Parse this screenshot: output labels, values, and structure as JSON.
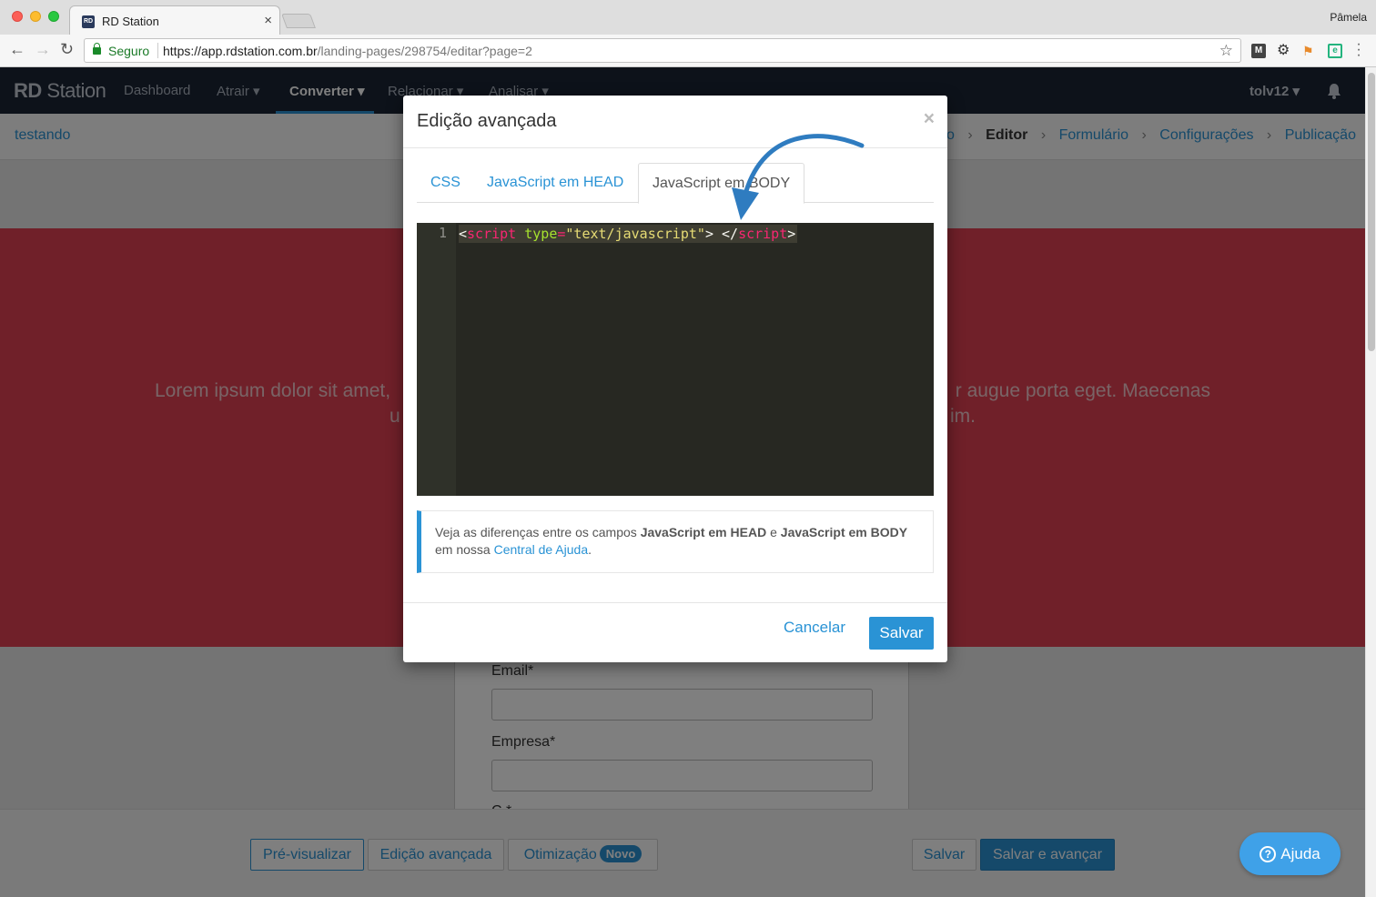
{
  "browser": {
    "tab_title": "RD Station",
    "tab_favicon_text": "RD",
    "profile_name": "Pâmela",
    "secure_label": "Seguro",
    "url_scheme_host": "https://app.rdstation.com.br",
    "url_path": "/landing-pages/298754/editar?page=2"
  },
  "app_nav": {
    "brand_bold": "RD",
    "brand_rest": " Station",
    "items": [
      {
        "label": "Dashboard"
      },
      {
        "label": "Atrair ▾"
      },
      {
        "label": "Converter ▾"
      },
      {
        "label": "Relacionar ▾"
      },
      {
        "label": "Analisar ▾"
      }
    ],
    "active_item": "Converter",
    "user": "tolv12 ▾"
  },
  "subheader": {
    "page_name": "testando",
    "steps": [
      "o",
      "Editor",
      "Formulário",
      "Configurações",
      "Publicação"
    ],
    "current_step": "Editor"
  },
  "hero": {
    "line1_left": "Lorem ipsum dolor sit amet,",
    "line1_right": "r augue porta eget. Maecenas",
    "line2_left": "u",
    "line2_right": "im."
  },
  "form": {
    "email_label": "Email*",
    "company_label": "Empresa*",
    "cut_label": "C     *"
  },
  "bottom_bar": {
    "preview": "Pré-visualizar",
    "advanced": "Edição avançada",
    "optimization": "Otimização",
    "badge_new": "Novo",
    "save": "Salvar",
    "save_next": "Salvar e avançar"
  },
  "help_button": {
    "label": "Ajuda",
    "icon_glyph": "?"
  },
  "modal": {
    "title": "Edição avançada",
    "close_glyph": "×",
    "tabs": [
      {
        "label": "CSS"
      },
      {
        "label": "JavaScript em HEAD"
      },
      {
        "label": "JavaScript em BODY"
      }
    ],
    "active_tab": "JavaScript em BODY",
    "editor": {
      "line_number": "1",
      "tokens": {
        "lt1": "<",
        "tag1": "script",
        "space": " ",
        "attr": "type",
        "eq": "=",
        "str": "\"text/javascript\"",
        "gt1": ">",
        "space2": " ",
        "lt2": "</",
        "tag2": "script",
        "gt2": ">"
      }
    },
    "info": {
      "prefix": "Veja as diferenças entre os campos ",
      "bold1": "JavaScript em HEAD",
      "mid": " e ",
      "bold2": "JavaScript em BODY",
      "line2_prefix": "em nossa ",
      "link": "Central de Ajuda",
      "suffix": "."
    },
    "cancel": "Cancelar",
    "save": "Salvar"
  },
  "colors": {
    "primary": "#2a93d5",
    "nav_bg": "#1b2535",
    "hero_bg": "#e14152",
    "editor_bg": "#272822",
    "annotation_arrow": "#2f7cc0"
  }
}
